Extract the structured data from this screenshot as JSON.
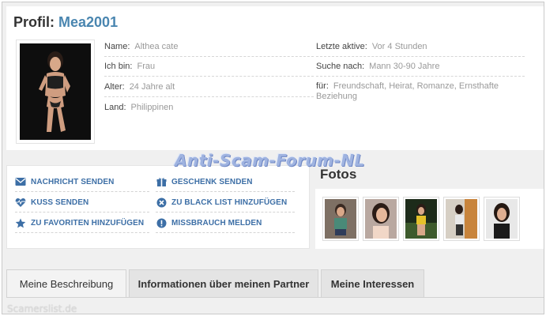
{
  "profile": {
    "title_prefix": "Profil:",
    "username": "Mea2001",
    "left_fields": [
      {
        "label": "Name:",
        "value": "Althea cate"
      },
      {
        "label": "Ich bin:",
        "value": "Frau"
      },
      {
        "label": "Alter:",
        "value": "24 Jahre alt"
      },
      {
        "label": "Land:",
        "value": "Philippinen"
      }
    ],
    "right_fields": [
      {
        "label": "Letzte aktive:",
        "value": "Vor 4 Stunden"
      },
      {
        "label": "Suche nach:",
        "value": "Mann 30-90 Jahre"
      },
      {
        "label": "für:",
        "value": "Freundschaft, Heirat, Romanze, Ernsthafte Beziehung"
      }
    ]
  },
  "watermark": "Anti-Scam-Forum-NL",
  "actions": [
    {
      "label": "NACHRICHT SENDEN",
      "icon": "envelope-icon"
    },
    {
      "label": "GESCHENK SENDEN",
      "icon": "gift-icon"
    },
    {
      "label": "KUSS SENDEN",
      "icon": "heartbeat-icon"
    },
    {
      "label": "ZU BLACK LIST HINZUFÜGEN",
      "icon": "block-icon"
    },
    {
      "label": "ZU FAVORITEN HINZUFÜGEN",
      "icon": "star-icon"
    },
    {
      "label": "MISSBRAUCH MELDEN",
      "icon": "warning-icon"
    }
  ],
  "fotos": {
    "title": "Fotos",
    "count": 5
  },
  "tabs": [
    {
      "label": "Meine Beschreibung"
    },
    {
      "label": "Informationen über meinen Partner"
    },
    {
      "label": "Meine Interessen"
    }
  ],
  "site_mark": "Scamerslist.de",
  "colors": {
    "accent": "#4a86b0",
    "action_text": "#3d6fa6",
    "value_text": "#999999"
  }
}
